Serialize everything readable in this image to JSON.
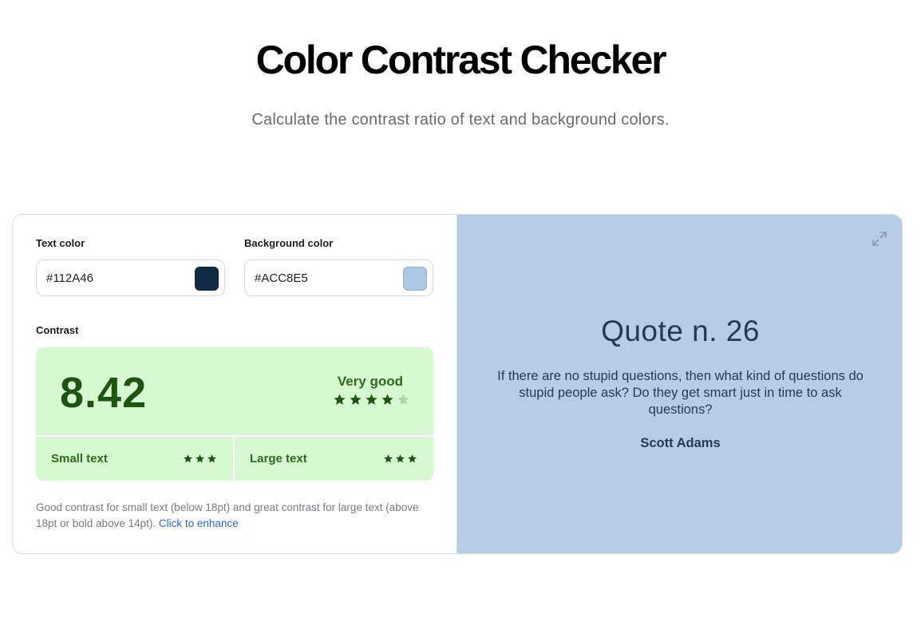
{
  "header": {
    "title": "Color Contrast Checker",
    "subtitle": "Calculate the contrast ratio of text and background colors."
  },
  "controls": {
    "text_color_label": "Text color",
    "text_color_value": "#112A46",
    "background_color_label": "Background color",
    "background_color_value": "#ACC8E5",
    "contrast_label": "Contrast"
  },
  "contrast": {
    "ratio": "8.42",
    "rating": "Very good",
    "rating_stars": 4,
    "rating_stars_max": 5,
    "small_text_label": "Small text",
    "small_text_stars": 3,
    "large_text_label": "Large text",
    "large_text_stars": 3
  },
  "note": {
    "text": "Good contrast for small text (below 18pt) and great contrast for large text (above 18pt or bold above 14pt).",
    "link": "Click to enhance"
  },
  "preview": {
    "quote_title": "Quote n. 26",
    "quote_text": "If there are no stupid questions, then what kind of questions do stupid people ask? Do they get smart just in time to ask questions?",
    "quote_author": "Scott Adams"
  },
  "colors": {
    "text": "#112A46",
    "background": "#ACC8E5",
    "good_bg": "#d7f9d2",
    "good_fg": "#1d5410",
    "link": "#2f63d6"
  },
  "icons": {
    "expand": "expand-icon",
    "star": "star-icon"
  }
}
